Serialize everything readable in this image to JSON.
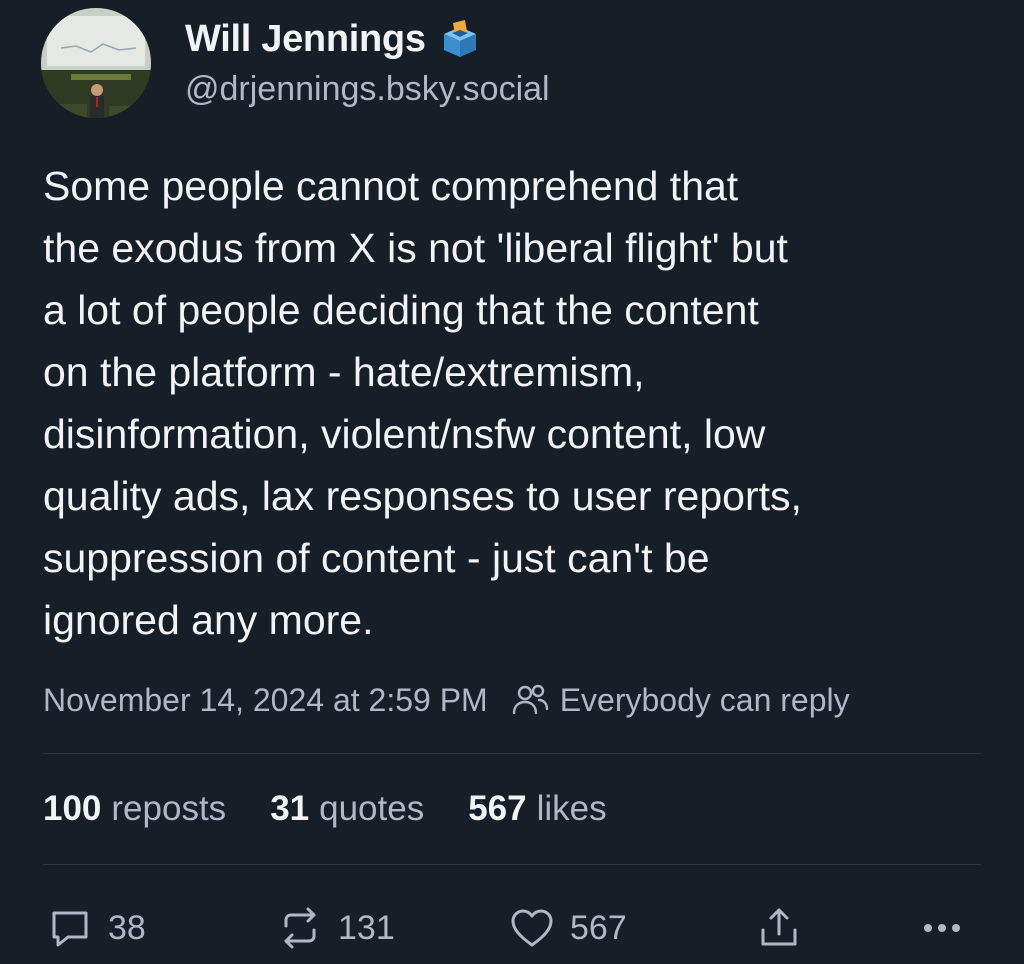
{
  "author": {
    "display_name": "Will Jennings",
    "handle": "@drjennings.bsky.social",
    "badge_icon": "ballot-box-icon",
    "avatar": "profile-photo"
  },
  "post": {
    "text": "Some people cannot comprehend that\nthe exodus from X is not 'liberal flight' but\na lot of people deciding that the content\non the platform - hate/extremism,\ndisinformation, violent/nsfw content, low\nquality ads, lax responses to user reports,\nsuppression of content - just can't be\nignored any more.",
    "timestamp": "November 14, 2024 at 2:59 PM",
    "reply_setting": "Everybody can reply"
  },
  "stats": {
    "reposts": {
      "value": "100",
      "label": "reposts"
    },
    "quotes": {
      "value": "31",
      "label": "quotes"
    },
    "likes": {
      "value": "567",
      "label": "likes"
    }
  },
  "actions": {
    "reply_count": "38",
    "repost_count": "131",
    "like_count": "567"
  },
  "colors": {
    "background": "#161e27",
    "text_primary": "#f1f3f5",
    "text_secondary": "#aeb9c5",
    "divider": "#2c3641"
  }
}
